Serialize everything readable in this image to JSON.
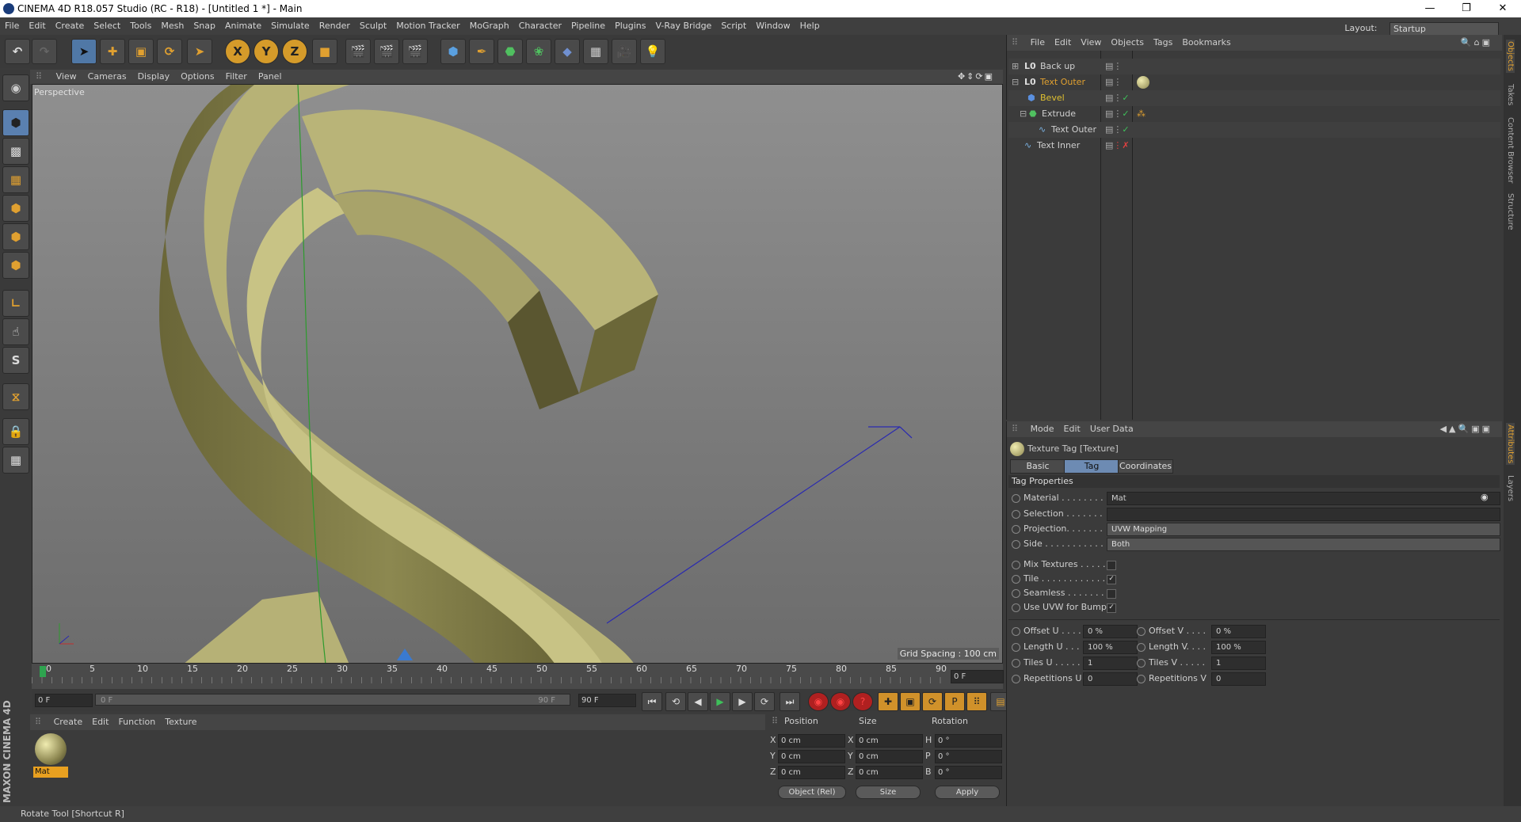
{
  "window": {
    "title": "CINEMA 4D R18.057 Studio (RC - R18) - [Untitled 1 *] - Main"
  },
  "menu": [
    "File",
    "Edit",
    "Create",
    "Select",
    "Tools",
    "Mesh",
    "Snap",
    "Animate",
    "Simulate",
    "Render",
    "Sculpt",
    "Motion Tracker",
    "MoGraph",
    "Character",
    "Pipeline",
    "Plugins",
    "V-Ray Bridge",
    "Script",
    "Window",
    "Help"
  ],
  "layout": {
    "label": "Layout:",
    "value": "Startup"
  },
  "viewport": {
    "menu": [
      "View",
      "Cameras",
      "Display",
      "Options",
      "Filter",
      "Panel"
    ],
    "label": "Perspective",
    "grid_spacing": "Grid Spacing : 100 cm"
  },
  "timeline": {
    "ticks": [
      "0",
      "5",
      "10",
      "15",
      "20",
      "25",
      "30",
      "35",
      "40",
      "45",
      "50",
      "55",
      "60",
      "65",
      "70",
      "75",
      "80",
      "85",
      "90"
    ],
    "current_frame": "0 F",
    "start": "0 F",
    "slider_start": "0 F",
    "slider_end": "90 F",
    "end": "90 F"
  },
  "material_manager": {
    "menu": [
      "Create",
      "Edit",
      "Function",
      "Texture"
    ],
    "materials": [
      {
        "name": "Mat"
      }
    ]
  },
  "coordinates": {
    "headers": {
      "position": "Position",
      "size": "Size",
      "rotation": "Rotation"
    },
    "rows": [
      {
        "axis": "X",
        "pos": "0 cm",
        "size_axis": "X",
        "size": "0 cm",
        "rot_axis": "H",
        "rot": "0 °"
      },
      {
        "axis": "Y",
        "pos": "0 cm",
        "size_axis": "Y",
        "size": "0 cm",
        "rot_axis": "P",
        "rot": "0 °"
      },
      {
        "axis": "Z",
        "pos": "0 cm",
        "size_axis": "Z",
        "size": "0 cm",
        "rot_axis": "B",
        "rot": "0 °"
      }
    ],
    "mode": "Object (Rel)",
    "size_mode": "Size",
    "apply": "Apply"
  },
  "objects": {
    "menu": [
      "File",
      "Edit",
      "View",
      "Objects",
      "Tags",
      "Bookmarks"
    ],
    "items": [
      {
        "name": "Back up",
        "indent": 0
      },
      {
        "name": "Text Outer",
        "indent": 0,
        "highlight": true
      },
      {
        "name": "Bevel",
        "indent": 1,
        "highlight": true
      },
      {
        "name": "Extrude",
        "indent": 1
      },
      {
        "name": "Text Outer",
        "indent": 2
      },
      {
        "name": "Text Inner",
        "indent": 0
      }
    ]
  },
  "side_tabs_top": [
    "Objects",
    "Takes",
    "Content Browser",
    "Structure"
  ],
  "side_tabs_bottom": [
    "Attributes",
    "Layers"
  ],
  "attributes": {
    "menu": [
      "Mode",
      "Edit",
      "User Data"
    ],
    "title": "Texture Tag [Texture]",
    "tabs": [
      "Basic",
      "Tag",
      "Coordinates"
    ],
    "section": "Tag Properties",
    "props": [
      {
        "label": "Material . . . . . . . .",
        "value": "Mat"
      },
      {
        "label": "Selection . . . . . . .",
        "value": ""
      },
      {
        "label": "Projection. . . . . . .",
        "value": "UVW Mapping"
      },
      {
        "label": "Side . . . . . . . . . . .",
        "value": "Both"
      }
    ],
    "checks": [
      {
        "label": "Mix Textures . . . . .",
        "checked": false
      },
      {
        "label": "Tile . . . . . . . . . . . .",
        "checked": true
      },
      {
        "label": "Seamless . . . . . . . .",
        "checked": false
      },
      {
        "label": "Use UVW for Bump",
        "checked": true
      }
    ],
    "uv_left": [
      {
        "label": "Offset U . . . .",
        "value": "0 %"
      },
      {
        "label": "Length U . . . .",
        "value": "100 %"
      },
      {
        "label": "Tiles U . . . . .",
        "value": "1"
      },
      {
        "label": "Repetitions U",
        "value": "0"
      }
    ],
    "uv_right": [
      {
        "label": "Offset V . . . .",
        "value": "0 %"
      },
      {
        "label": "Length V. . . .",
        "value": "100 %"
      },
      {
        "label": "Tiles V . . . . .",
        "value": "1"
      },
      {
        "label": "Repetitions V",
        "value": "0"
      }
    ]
  },
  "status": "Rotate Tool [Shortcut R]",
  "brand": "MAXON CINEMA 4D"
}
